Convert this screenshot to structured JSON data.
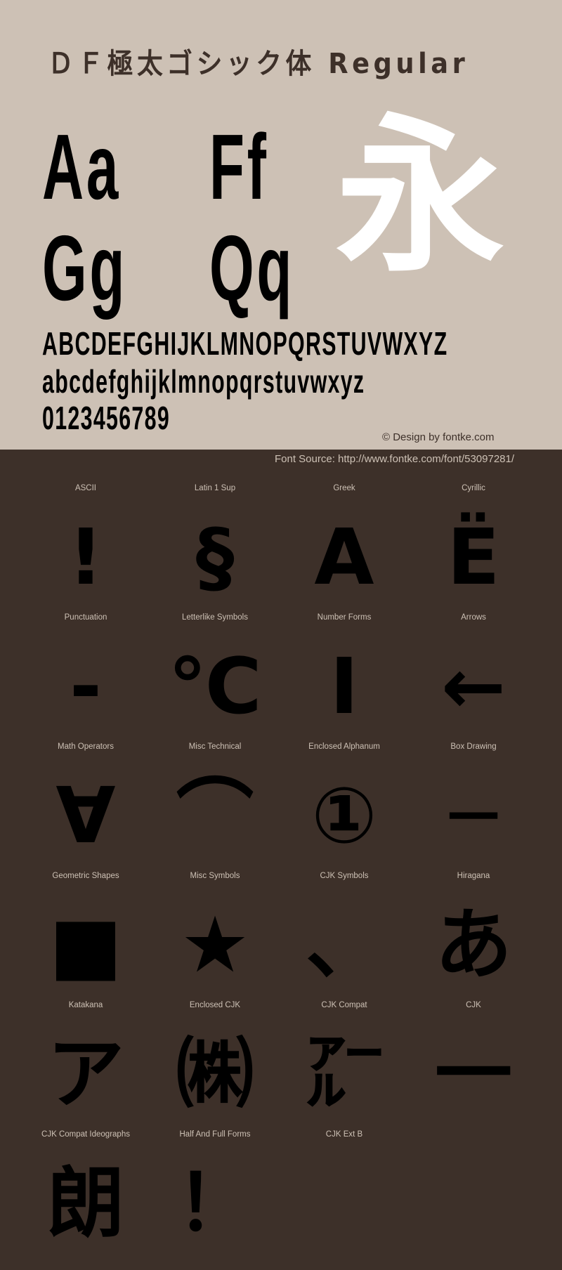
{
  "header": {
    "title": "ＤＦ極太ゴシック体 Regular",
    "preview_pairs": [
      "Aa",
      "Ff",
      "Gg",
      "Qq"
    ],
    "showcase_glyph": "永",
    "uppercase": "ABCDEFGHIJKLMNOPQRSTUVWXYZ",
    "lowercase": "abcdefghijklmnopqrstuvwxyz",
    "digits": "0123456789",
    "credit": "© Design by fontke.com"
  },
  "source": "Font Source: http://www.fontke.com/font/53097281/",
  "colors": {
    "light_bg": "#cdc1b5",
    "dark_bg": "#3d3029",
    "glyph": "#000000",
    "showcase": "#ffffff"
  },
  "blocks": [
    {
      "label": "ASCII",
      "glyph": "!"
    },
    {
      "label": "Latin 1 Sup",
      "glyph": "§"
    },
    {
      "label": "Greek",
      "glyph": "Α"
    },
    {
      "label": "Cyrillic",
      "glyph": "Ё"
    },
    {
      "label": "Punctuation",
      "glyph": "‐"
    },
    {
      "label": "Letterlike Symbols",
      "glyph": "℃"
    },
    {
      "label": "Number Forms",
      "glyph": "Ⅰ"
    },
    {
      "label": "Arrows",
      "glyph": "←"
    },
    {
      "label": "Math Operators",
      "glyph": "∀"
    },
    {
      "label": "Misc Technical",
      "glyph": "⌒"
    },
    {
      "label": "Enclosed Alphanum",
      "glyph": "①"
    },
    {
      "label": "Box Drawing",
      "glyph": "─"
    },
    {
      "label": "Geometric Shapes",
      "glyph": "■"
    },
    {
      "label": "Misc Symbols",
      "glyph": "★"
    },
    {
      "label": "CJK Symbols",
      "glyph": "、"
    },
    {
      "label": "Hiragana",
      "glyph": "あ"
    },
    {
      "label": "Katakana",
      "glyph": "ア"
    },
    {
      "label": "Enclosed CJK",
      "glyph": "㈱"
    },
    {
      "label": "CJK Compat",
      "glyph": "㌃"
    },
    {
      "label": "CJK",
      "glyph": "一"
    },
    {
      "label": "CJK Compat Ideographs",
      "glyph": "朗"
    },
    {
      "label": "Half And Full Forms",
      "glyph": "！"
    },
    {
      "label": "CJK Ext B",
      "glyph": ""
    }
  ]
}
